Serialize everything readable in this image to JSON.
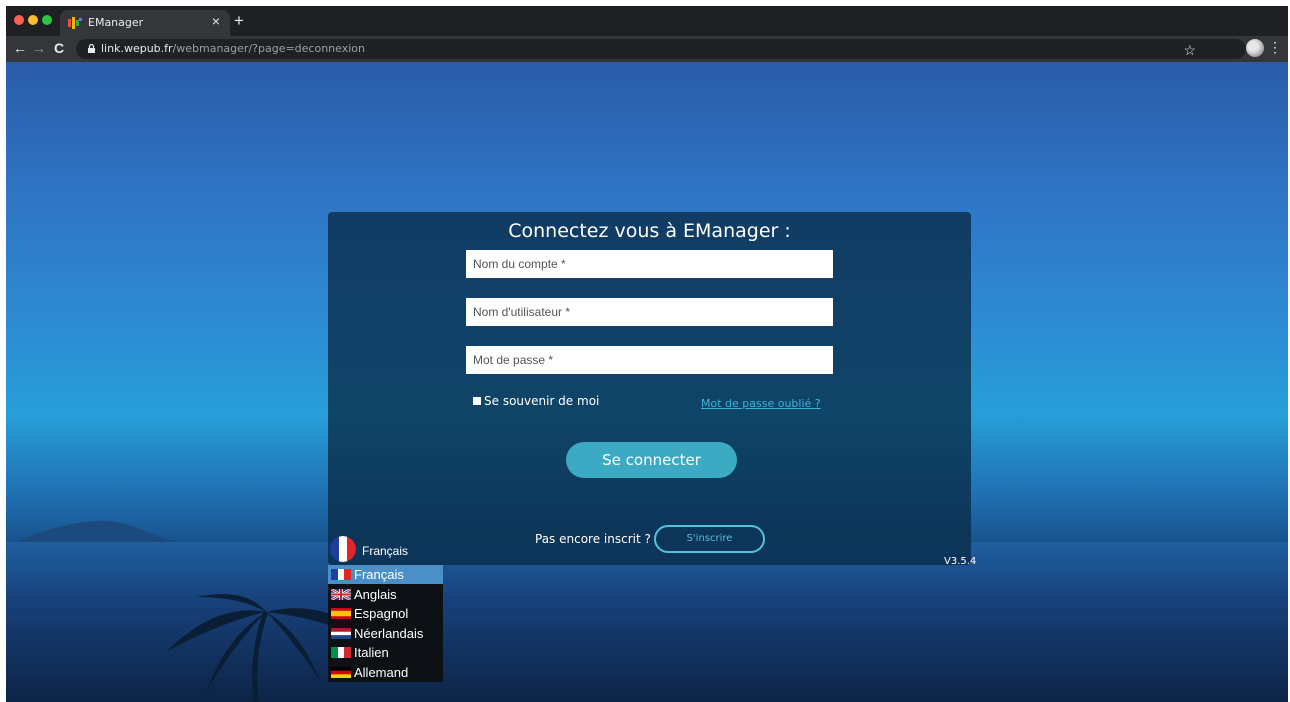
{
  "browser": {
    "tab_title": "EManager",
    "tab_close": "×",
    "new_tab": "+",
    "url_host": "link.wepub.fr",
    "url_path": "/webmanager/?page=deconnexion",
    "back": "←",
    "forward": "→",
    "reload": "C",
    "star": "☆",
    "menu": "⋮"
  },
  "login": {
    "title": "Connectez vous à EManager :",
    "account_placeholder": "Nom du compte *",
    "username_placeholder": "Nom d'utilisateur *",
    "password_placeholder": "Mot de passe *",
    "remember_label": "Se souvenir de moi",
    "forgot_link": "Mot de passe oublié ?",
    "connect_button": "Se connecter",
    "not_registered": "Pas encore inscrit ?",
    "signup_button": "S'inscrire",
    "version": "V3.5.4"
  },
  "language": {
    "current": "Français",
    "options": [
      {
        "label": "Français",
        "flag": "fr-flag-icon",
        "selected": true
      },
      {
        "label": "Anglais",
        "flag": "uk-flag-icon",
        "selected": false
      },
      {
        "label": "Espagnol",
        "flag": "es-flag-icon",
        "selected": false
      },
      {
        "label": "Néerlandais",
        "flag": "nl-flag-icon",
        "selected": false
      },
      {
        "label": "Italien",
        "flag": "it-flag-icon",
        "selected": false
      },
      {
        "label": "Allemand",
        "flag": "de-flag-icon",
        "selected": false
      }
    ]
  },
  "colors": {
    "accent": "#3caac2",
    "link": "#3fb3d6",
    "panel": "#092c48"
  }
}
